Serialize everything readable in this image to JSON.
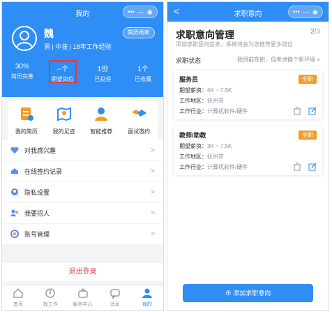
{
  "left": {
    "title": "我的",
    "capsule": {
      "more": "•••",
      "minus": "—",
      "target": "◉"
    },
    "profile": {
      "name": "魏",
      "info": "男 | 中技 | 18年工作经验",
      "refresh": "简历刷新"
    },
    "stats": [
      {
        "value": "30%",
        "label": "简历完善"
      },
      {
        "value": "--个",
        "label": "期望岗位"
      },
      {
        "value": "1份",
        "label": "已投递"
      },
      {
        "value": "1个",
        "label": "已收藏"
      }
    ],
    "quick": [
      {
        "label": "我的简历",
        "icon": "resume-icon"
      },
      {
        "label": "我的足迹",
        "icon": "map-icon"
      },
      {
        "label": "智能推荐",
        "icon": "recommend-icon"
      },
      {
        "label": "面试邀约",
        "icon": "handshake-icon"
      }
    ],
    "menu": [
      {
        "label": "对我感兴趣",
        "icon": "heart-icon"
      },
      {
        "label": "在线签约记录",
        "icon": "contract-icon"
      },
      {
        "label": "隐私设置",
        "icon": "privacy-icon"
      },
      {
        "label": "我要招人",
        "icon": "recruit-icon"
      },
      {
        "label": "账号管理",
        "icon": "account-icon"
      }
    ],
    "logout": "退出登录",
    "tabs": [
      {
        "label": "首页",
        "icon": "home-icon"
      },
      {
        "label": "找工作",
        "icon": "job-icon"
      },
      {
        "label": "服务中心",
        "icon": "service-icon"
      },
      {
        "label": "消息",
        "icon": "message-icon"
      },
      {
        "label": "我的",
        "icon": "user-icon"
      }
    ]
  },
  "right": {
    "title": "求职意向",
    "back": "<",
    "capsule": {
      "more": "•••",
      "minus": "—",
      "target": "◉"
    },
    "heading": "求职意向管理",
    "step": "2",
    "step_total": "/3",
    "subtitle": "添加求职意向信息，系统将会为您推荐更多岗位",
    "status_label": "求职状态",
    "status_value": "我目前在职，但考虑换个新环境 >",
    "cards": [
      {
        "title": "服务员",
        "tag": "全职",
        "salary_k": "期望薪资：",
        "salary": "4K ~ 7.5K",
        "area_k": "工作地区：",
        "area": "抚州市",
        "industry_k": "工作行业：",
        "industry": "计算机软件/硬件"
      },
      {
        "title": "教师/助教",
        "tag": "全职",
        "salary_k": "期望薪资：",
        "salary": "3K ~ 7.5K",
        "area_k": "工作地区：",
        "area": "抚州市",
        "industry_k": "工作行业：",
        "industry": "计算机软件/硬件"
      }
    ],
    "add_button": "⊕ 添加求职意向"
  },
  "colors": {
    "primary": "#2f8df6",
    "orange": "#f59a23",
    "danger": "#e5484d",
    "highlight_box": "#e53935"
  }
}
